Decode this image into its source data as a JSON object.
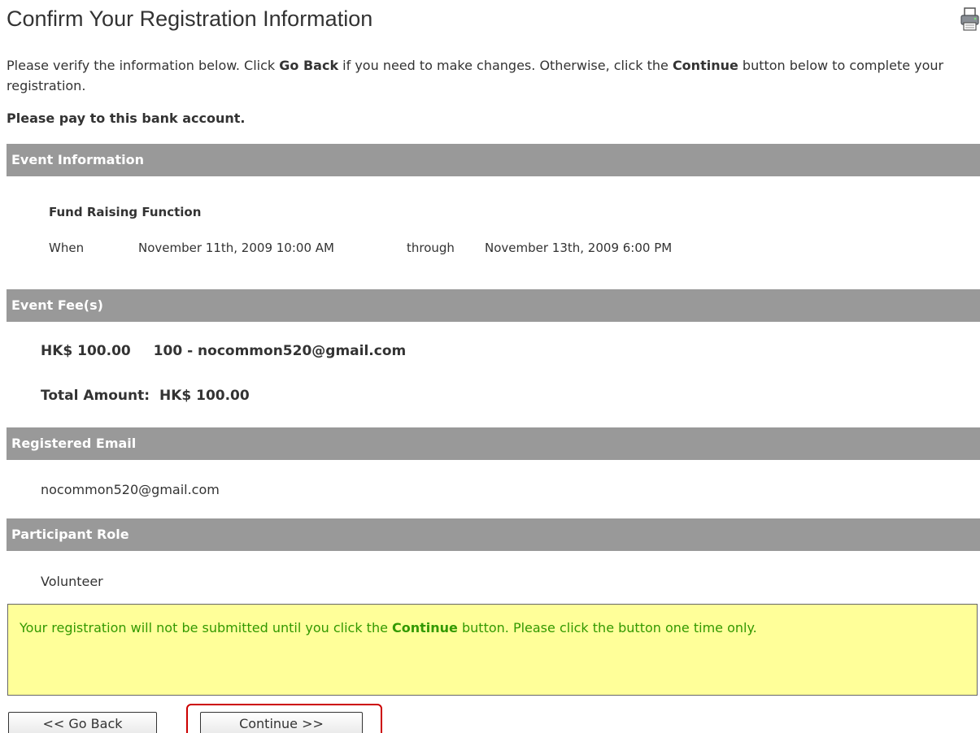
{
  "header": {
    "title": "Confirm Your Registration Information",
    "print_icon": "printer-icon"
  },
  "intro": {
    "part1": "Please verify the information below. Click ",
    "go_back_bold": "Go Back",
    "part2": " if you need to make changes. Otherwise, click the ",
    "continue_bold": "Continue",
    "part3": " button below to complete your registration."
  },
  "pay_note": "Please pay to this bank account.",
  "sections": {
    "event_information": "Event Information",
    "event_fees": "Event Fee(s)",
    "registered_email": "Registered Email",
    "participant_role": "Participant Role"
  },
  "event": {
    "name": "Fund Raising Function",
    "when_label": "When",
    "start": "November 11th, 2009 10:00 AM",
    "through_label": "through",
    "end": "November 13th, 2009 6:00 PM"
  },
  "fees": {
    "amount": "HK$ 100.00",
    "description": "100 - nocommon520@gmail.com",
    "total_label": "Total Amount:",
    "total_value": "HK$ 100.00"
  },
  "registered_email": "nocommon520@gmail.com",
  "participant_role": "Volunteer",
  "notice": {
    "part1": "Your registration will not be submitted until you click the ",
    "continue_bold": "Continue",
    "part2": " button. Please click the button one time only."
  },
  "buttons": {
    "go_back": "<< Go Back",
    "continue": "Continue >>"
  },
  "colors": {
    "section_bar": "#999999",
    "notice_background": "#ffff99",
    "notice_text": "#339900",
    "highlight_border": "#cc0000"
  }
}
